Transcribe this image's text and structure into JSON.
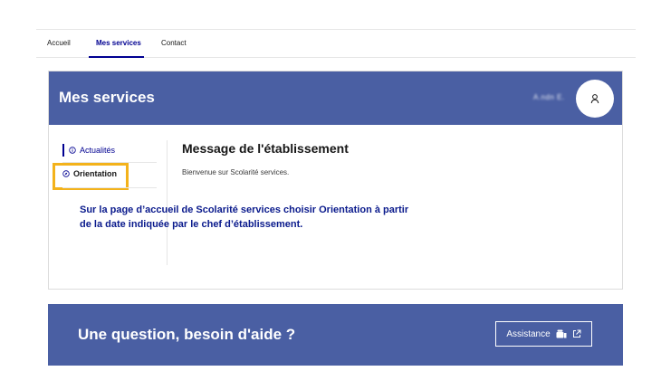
{
  "nav": {
    "items": [
      {
        "label": "Accueil"
      },
      {
        "label": "Mes services"
      },
      {
        "label": "Contact"
      }
    ],
    "active": "Mes services"
  },
  "services": {
    "title": "Mes services",
    "user_name": "A.ndn E."
  },
  "sidebar": {
    "items": [
      {
        "label": "Actualités",
        "icon": "info-circle-icon"
      },
      {
        "label": "Orientation",
        "icon": "compass-icon"
      }
    ]
  },
  "message": {
    "title": "Message de l'établissement",
    "text": "Bienvenue sur Scolarité services."
  },
  "annotation": {
    "line1": "Sur la page d’accueil de Scolarité services choisir Orientation à partir",
    "line2": "de la date indiquée par le chef d’établissement."
  },
  "help": {
    "title": "Une question, besoin d'aide ?",
    "button_label": "Assistance"
  },
  "colors": {
    "header_blue": "#4a5fa3",
    "link_blue": "#000091",
    "highlight_yellow": "#f3b21b",
    "annotation_blue": "#0a1a8c"
  }
}
